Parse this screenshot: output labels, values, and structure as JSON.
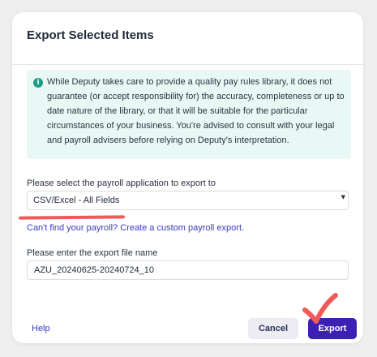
{
  "dialog": {
    "title": "Export Selected Items",
    "notice": "While Deputy takes care to provide a quality pay rules library, it does not guarantee (or accept responsibility for) the accuracy, completeness or up to date nature of the library, or that it will be suitable for the particular circumstances of your business. You're advised to consult with your legal and payroll advisers before relying on Deputy's interpretation.",
    "payroll_label": "Please select the payroll application to export to",
    "payroll_selected": "CSV/Excel - All Fields",
    "custom_payroll_link": "Can't find your payroll? Create a custom payroll export.",
    "file_name_label": "Please enter the export file name",
    "file_name_value": "AZU_20240625-20240724_10",
    "help_label": "Help",
    "cancel_label": "Cancel",
    "export_label": "Export"
  },
  "icons": {
    "notice_icon": "info-icon",
    "select_icon": "dropdown-arrow-icon"
  },
  "colors": {
    "accent": "#3b20b3",
    "link": "#3a3ac2",
    "notice_bg": "#eaf8f5",
    "info_icon": "#1f9c86",
    "annotation": "#f05a5a"
  }
}
